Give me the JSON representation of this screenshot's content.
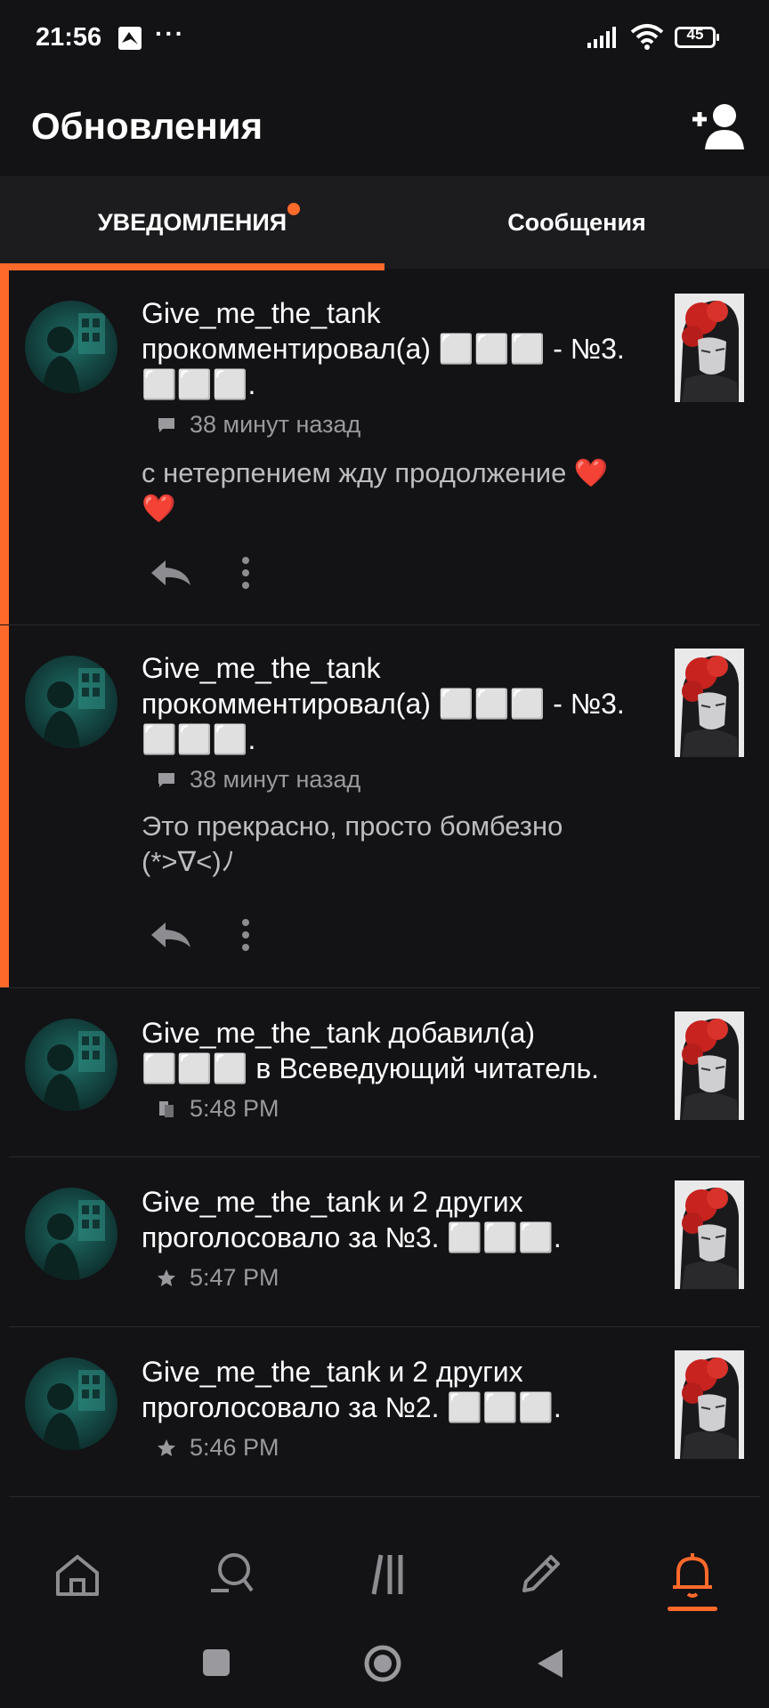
{
  "status_bar": {
    "time": "21:56",
    "dots": "···",
    "battery_level": "45"
  },
  "header": {
    "title": "Обновления"
  },
  "tabs": [
    {
      "label": "УВЕДОМЛЕНИЯ",
      "active": true,
      "has_dot": true
    },
    {
      "label": "Сообщения",
      "active": false
    }
  ],
  "accent_color": "#ff6a2b",
  "notifications": [
    {
      "text": "Give_me_the_tank прокомментировал(а) ⬜⬜⬜ - №3. ⬜⬜⬜.",
      "meta_icon": "comment-icon",
      "time": "38 минут назад",
      "comment": "с нетерпением жду продолжение ❤️❤️",
      "unread": true
    },
    {
      "text": "Give_me_the_tank прокомментировал(а) ⬜⬜⬜ - №3. ⬜⬜⬜.",
      "meta_icon": "comment-icon",
      "time": "38 минут назад",
      "comment": "Это прекрасно, просто бомбезно (*>∇<)ﾉ",
      "unread": true
    },
    {
      "text": "Give_me_the_tank добавил(а) ⬜⬜⬜ в Всеведующий читатель.",
      "meta_icon": "library-icon",
      "time": "5:48 PM",
      "unread": false
    },
    {
      "text": "Give_me_the_tank и 2 других проголосовало за №3. ⬜⬜⬜.",
      "meta_icon": "star-icon",
      "time": "5:47 PM",
      "unread": false
    },
    {
      "text": "Give_me_the_tank и 2 других проголосовало за №2. ⬜⬜⬜.",
      "meta_icon": "star-icon",
      "time": "5:46 PM",
      "unread": false
    }
  ],
  "bottom_nav": [
    {
      "icon": "home-icon"
    },
    {
      "icon": "search-icon"
    },
    {
      "icon": "library-icon"
    },
    {
      "icon": "write-icon"
    },
    {
      "icon": "bell-icon",
      "active": true
    }
  ]
}
